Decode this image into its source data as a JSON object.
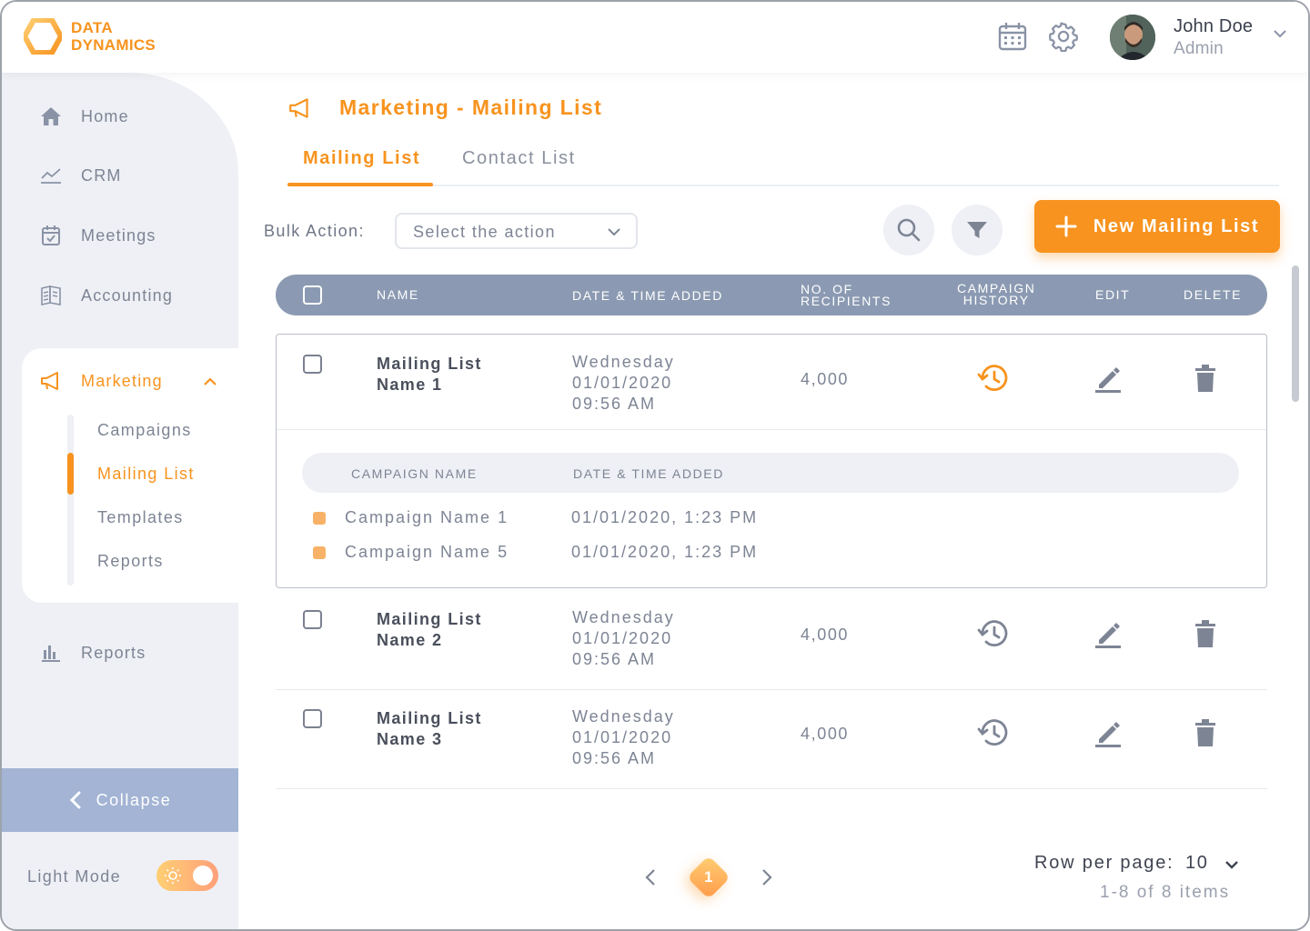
{
  "brand": {
    "line1": "DATA",
    "line2": "DYNAMICS",
    "accent": "#f7931e"
  },
  "header": {
    "icons": [
      "calendar-icon",
      "gear-icon"
    ],
    "user": {
      "name": "John Doe",
      "role": "Admin"
    }
  },
  "sidebar": {
    "items": [
      {
        "label": "Home",
        "icon": "home-icon"
      },
      {
        "label": "CRM",
        "icon": "chart-line-icon"
      },
      {
        "label": "Meetings",
        "icon": "calendar-check-icon"
      },
      {
        "label": "Accounting",
        "icon": "ledger-icon"
      },
      {
        "label": "Marketing",
        "icon": "megaphone-icon"
      },
      {
        "label": "Reports",
        "icon": "bar-chart-icon"
      }
    ],
    "marketing_sub": [
      "Campaigns",
      "Mailing List",
      "Templates",
      "Reports"
    ],
    "active_sub": "Mailing List",
    "collapse_label": "Collapse",
    "light_mode_label": "Light Mode"
  },
  "page": {
    "title": "Marketing - Mailing List",
    "tabs": [
      {
        "label": "Mailing List",
        "active": true
      },
      {
        "label": "Contact List",
        "active": false
      }
    ],
    "bulk_action_label": "Bulk Action:",
    "bulk_action_placeholder": "Select the action",
    "new_button_label": "New Mailing List"
  },
  "table": {
    "columns": {
      "name": "NAME",
      "date": "DATE & TIME ADDED",
      "recipients_1": "NO. OF",
      "recipients_2": "RECIPIENTS",
      "history_1": "CAMPAIGN",
      "history_2": "HISTORY",
      "edit": "EDIT",
      "delete": "DELETE"
    },
    "rows": [
      {
        "name_1": "Mailing List",
        "name_2": "Name 1",
        "day": "Wednesday",
        "date": "01/01/2020",
        "time": "09:56 AM",
        "recipients": "4,000",
        "expanded": true
      },
      {
        "name_1": "Mailing List",
        "name_2": "Name 2",
        "day": "Wednesday",
        "date": "01/01/2020",
        "time": "09:56 AM",
        "recipients": "4,000",
        "expanded": false
      },
      {
        "name_1": "Mailing List",
        "name_2": "Name 3",
        "day": "Wednesday",
        "date": "01/01/2020",
        "time": "09:56 AM",
        "recipients": "4,000",
        "expanded": false
      }
    ],
    "sub_columns": {
      "campaign_name": "CAMPAIGN NAME",
      "date": "DATE & TIME ADDED"
    },
    "campaigns": [
      {
        "name": "Campaign Name 1",
        "date": "01/01/2020, 1:23 PM"
      },
      {
        "name": "Campaign Name 5",
        "date": "01/01/2020, 1:23 PM"
      }
    ]
  },
  "pagination": {
    "current_page": "1",
    "rows_per_page_label": "Row per page:",
    "rows_per_page_value": "10",
    "items_summary": "1-8 of 8 items"
  }
}
